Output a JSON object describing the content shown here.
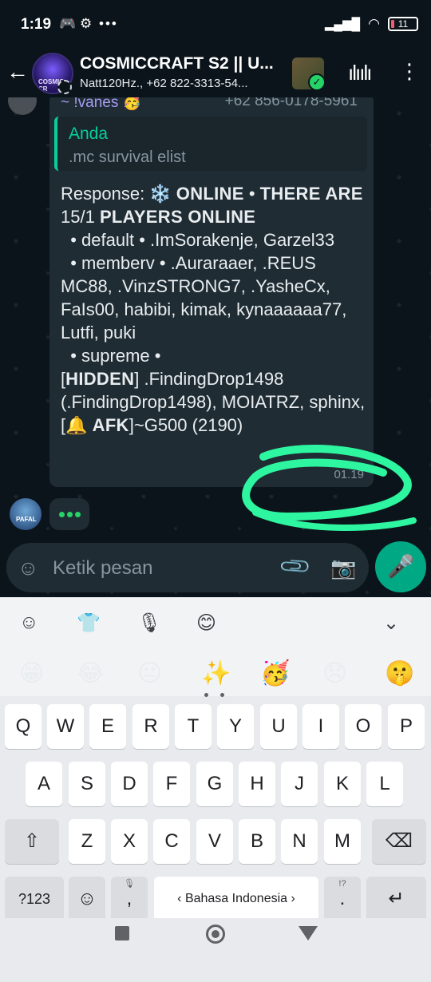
{
  "status_bar": {
    "time": "1:19",
    "battery": "11",
    "more_dots": "•••"
  },
  "header": {
    "title": "COSMICCRAFT S2 || U...",
    "subtitle": "Natt120Hz., +62 822-3313-54...",
    "avatar_text": "COSMIC CR"
  },
  "message": {
    "sender_name": "~ !vanes 🥳",
    "sender_phone": "+62 856-0178-5961",
    "quote_author": "Anda",
    "quote_text": ".mc survival elist",
    "body_prefix": "Response: ❄️ ",
    "online_word": "ONLINE",
    "sep1": " • ",
    "there_are": "THERE ARE",
    "count": "15/1 ",
    "players_online": "PLAYERS ONLINE",
    "line_default": "\n  • default • .ImSorakenje, Garzel33\n  • memberv • .Auraraaer, .REUS MC88, .VinzSTRONG7, .YasheCx, FaIs00, habibi, kimak, kynaaaaaa77, Lutfi, puki\n  • supreme •\n[",
    "hidden": "HIDDEN",
    "line_rest": "] .FindingDrop1498 (.FindingDrop1498), MOIATRZ, sphinx, [🔔 ",
    "afk": "AFK",
    "line_end": "]~G500 (2190)",
    "time": "01.19"
  },
  "typing_avatar_text": "PAFAL",
  "input": {
    "placeholder": "Ketik pesan"
  },
  "keyboard": {
    "row1": [
      "Q",
      "W",
      "E",
      "R",
      "T",
      "Y",
      "U",
      "I",
      "O",
      "P"
    ],
    "row2": [
      "A",
      "S",
      "D",
      "F",
      "G",
      "H",
      "J",
      "K",
      "L"
    ],
    "row3": [
      "Z",
      "X",
      "C",
      "V",
      "B",
      "N",
      "M"
    ],
    "symbols_label": "?123",
    "comma": ",",
    "space_label": "Bahasa Indonesia",
    "period": ".",
    "period_sub": "!?",
    "emojis": [
      "😁",
      "😂",
      "😐",
      "✨",
      "🥳",
      "😞",
      "🤫"
    ]
  },
  "colors": {
    "accent": "#00a884",
    "quote_bar": "#06cf9c",
    "scribble": "#2ef5a0",
    "sender": "#a69cf2"
  }
}
